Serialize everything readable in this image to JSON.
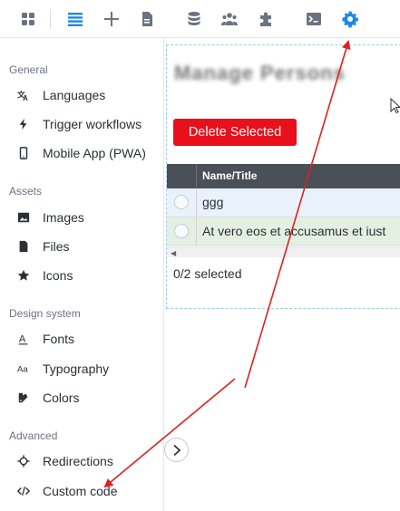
{
  "toolbar": {
    "icons": [
      "apps-icon",
      "list-icon",
      "plus-icon",
      "page-icon",
      "database-icon",
      "users-icon",
      "puzzle-icon",
      "terminal-icon",
      "gear-icon"
    ],
    "active": "gear-icon",
    "accent": "#1e88e5"
  },
  "sidebar": {
    "sections": [
      {
        "title": "General",
        "items": [
          {
            "label": "Languages",
            "icon": "translate-icon"
          },
          {
            "label": "Trigger workflows",
            "icon": "bolt-icon"
          },
          {
            "label": "Mobile App (PWA)",
            "icon": "phone-icon"
          }
        ]
      },
      {
        "title": "Assets",
        "items": [
          {
            "label": "Images",
            "icon": "image-icon"
          },
          {
            "label": "Files",
            "icon": "file-icon"
          },
          {
            "label": "Icons",
            "icon": "star-icon"
          }
        ]
      },
      {
        "title": "Design system",
        "items": [
          {
            "label": "Fonts",
            "icon": "font-icon"
          },
          {
            "label": "Typography",
            "icon": "typography-icon"
          },
          {
            "label": "Colors",
            "icon": "palette-icon"
          }
        ]
      },
      {
        "title": "Advanced",
        "items": [
          {
            "label": "Redirections",
            "icon": "redirect-icon"
          },
          {
            "label": "Custom code",
            "icon": "code-icon"
          }
        ]
      }
    ]
  },
  "main": {
    "blurred_title": "Manage Persons",
    "delete_button": "Delete Selected",
    "delete_color": "#e8101a",
    "table": {
      "column": "Name/Title",
      "rows": [
        "ggg",
        "At vero eos et accusamus et iust"
      ]
    },
    "selected": "0/2 selected"
  },
  "annotation": {
    "arrow_color": "#e02020"
  }
}
